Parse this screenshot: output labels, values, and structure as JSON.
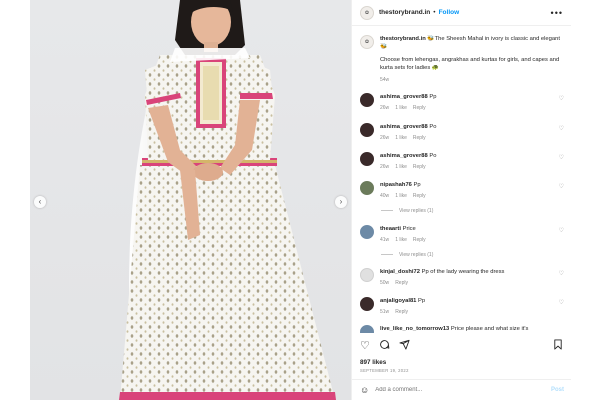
{
  "post": {
    "username": "thestorybrand.in",
    "follow_label": "Follow",
    "more_label": "•••",
    "separator": "•"
  },
  "caption": {
    "username": "thestorybrand.in",
    "text_line1": "🐝The Sheesh Mahal in ivory is classic and elegant 🐝",
    "text_line2": "Choose from lehengas, angrakhas and kurtas for girls, and capes and kurta sets for ladies 🐢",
    "time": "54w"
  },
  "comments": [
    {
      "username": "ashima_grover88",
      "text": "Pp",
      "time": "26w",
      "likes": "1 like",
      "reply": "Reply"
    },
    {
      "username": "ashima_grover88",
      "text": "Po",
      "time": "26w",
      "likes": "1 like",
      "reply": "Reply"
    },
    {
      "username": "ashima_grover88",
      "text": "Po",
      "time": "26w",
      "likes": "1 like",
      "reply": "Reply"
    },
    {
      "username": "nipashah76",
      "text": "Pp",
      "time": "40w",
      "likes": "1 like",
      "reply": "Reply",
      "view_replies": "View replies (1)"
    },
    {
      "username": "theaarti",
      "text": "Price",
      "time": "41w",
      "likes": "1 like",
      "reply": "Reply",
      "view_replies": "View replies (1)"
    },
    {
      "username": "kinjal_doshi72",
      "text": "Pp of the lady wearing the dress",
      "time": "50w",
      "reply": "Reply"
    },
    {
      "username": "anjaligoyal81",
      "text": "Pp",
      "time": "51w",
      "reply": "Reply"
    },
    {
      "username": "live_like_no_tomorrow13",
      "text": "Price please and what size it's"
    }
  ],
  "likes_label": "897 likes",
  "date_label": "SEPTEMBER 19, 2022",
  "add_comment_placeholder": "Add a comment...",
  "post_label": "Post",
  "icons": {
    "heart": "heart-icon",
    "comment": "comment-icon",
    "share": "share-icon",
    "save": "bookmark-icon",
    "emoji": "emoji-icon",
    "prev": "chevron-left-icon",
    "next": "chevron-right-icon"
  },
  "colors": {
    "accent": "#0095f6",
    "muted": "#8e8e8e",
    "post_disabled": "#b2dffc",
    "dress_trim": "#d9447a",
    "dress_gold": "#d4b56a"
  }
}
